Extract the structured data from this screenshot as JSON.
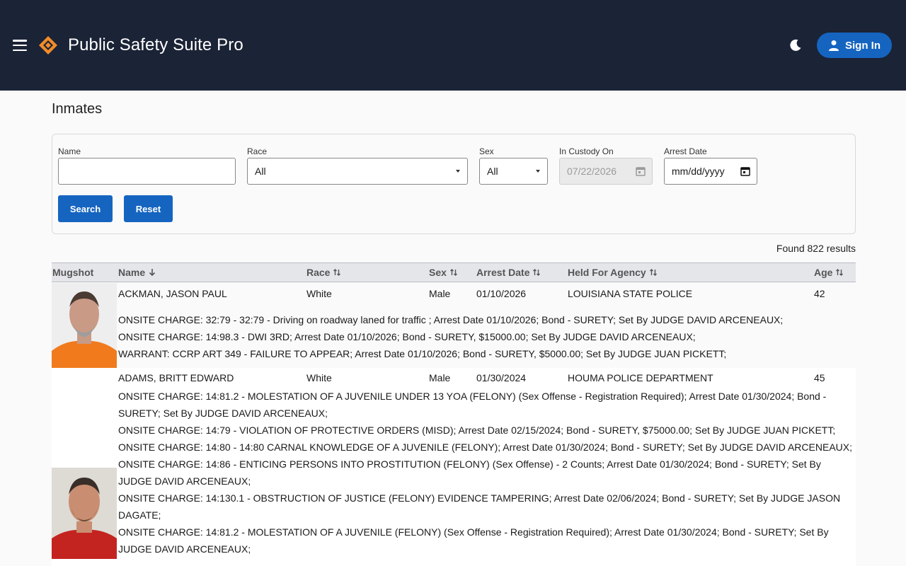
{
  "header": {
    "title": "Public Safety Suite Pro",
    "sign_in_label": "Sign In"
  },
  "page": {
    "title": "Inmates"
  },
  "filters": {
    "name_label": "Name",
    "name_value": "",
    "race_label": "Race",
    "race_value": "All",
    "sex_label": "Sex",
    "sex_value": "All",
    "custody_label": "In Custody On",
    "custody_value": "07/22/2026",
    "arrest_label": "Arrest Date",
    "arrest_value": "mm/dd/yyyy",
    "search_label": "Search",
    "reset_label": "Reset"
  },
  "results": {
    "count_text": "Found 822 results"
  },
  "table": {
    "columns": {
      "mugshot": "Mugshot",
      "name": "Name",
      "race": "Race",
      "sex": "Sex",
      "arrest_date": "Arrest Date",
      "agency": "Held For Agency",
      "age": "Age"
    },
    "rows": [
      {
        "name": "ACKMAN, JASON PAUL",
        "race": "White",
        "sex": "Male",
        "arrest_date": "01/10/2026",
        "agency": "LOUISIANA STATE POLICE",
        "age": "42",
        "charges": [
          "ONSITE CHARGE: 32:79 - 32:79 - Driving on roadway laned for traffic ; Arrest Date 01/10/2026; Bond - SURETY; Set By JUDGE DAVID ARCENEAUX;",
          "ONSITE CHARGE: 14:98.3 - DWI 3RD; Arrest Date 01/10/2026; Bond - SURETY, $15000.00; Set By JUDGE DAVID ARCENEAUX;",
          "WARRANT: CCRP ART 349 - FAILURE TO APPEAR; Arrest Date 01/10/2026; Bond - SURETY, $5000.00; Set By JUDGE JUAN PICKETT;"
        ]
      },
      {
        "name": "ADAMS, BRITT EDWARD",
        "race": "White",
        "sex": "Male",
        "arrest_date": "01/30/2024",
        "agency": "HOUMA POLICE DEPARTMENT",
        "age": "45",
        "charges": [
          "ONSITE CHARGE: 14:81.2 - MOLESTATION OF A JUVENILE UNDER 13 YOA (FELONY) (Sex Offense - Registration Required); Arrest Date 01/30/2024; Bond - SURETY; Set By JUDGE DAVID ARCENEAUX;",
          "ONSITE CHARGE: 14:79 - VIOLATION OF PROTECTIVE ORDERS (MISD); Arrest Date 02/15/2024; Bond - SURETY, $75000.00; Set By JUDGE JUAN PICKETT;",
          "ONSITE CHARGE: 14:80 - 14:80 CARNAL KNOWLEDGE OF A JUVENILE (FELONY); Arrest Date 01/30/2024; Bond - SURETY; Set By JUDGE DAVID ARCENEAUX;",
          "ONSITE CHARGE: 14:86 - ENTICING PERSONS INTO PROSTITUTION (FELONY) (Sex Offense) - 2 Counts; Arrest Date 01/30/2024; Bond - SURETY; Set By JUDGE DAVID ARCENEAUX;",
          "ONSITE CHARGE: 14:130.1 - OBSTRUCTION OF JUSTICE (FELONY) EVIDENCE TAMPERING; Arrest Date 02/06/2024; Bond - SURETY; Set By JUDGE JASON DAGATE;",
          "ONSITE CHARGE: 14:81.2 - MOLESTATION OF A JUVENILE (FELONY) (Sex Offense - Registration Required); Arrest Date 01/30/2024; Bond - SURETY; Set By JUDGE DAVID ARCENEAUX;"
        ]
      }
    ]
  }
}
